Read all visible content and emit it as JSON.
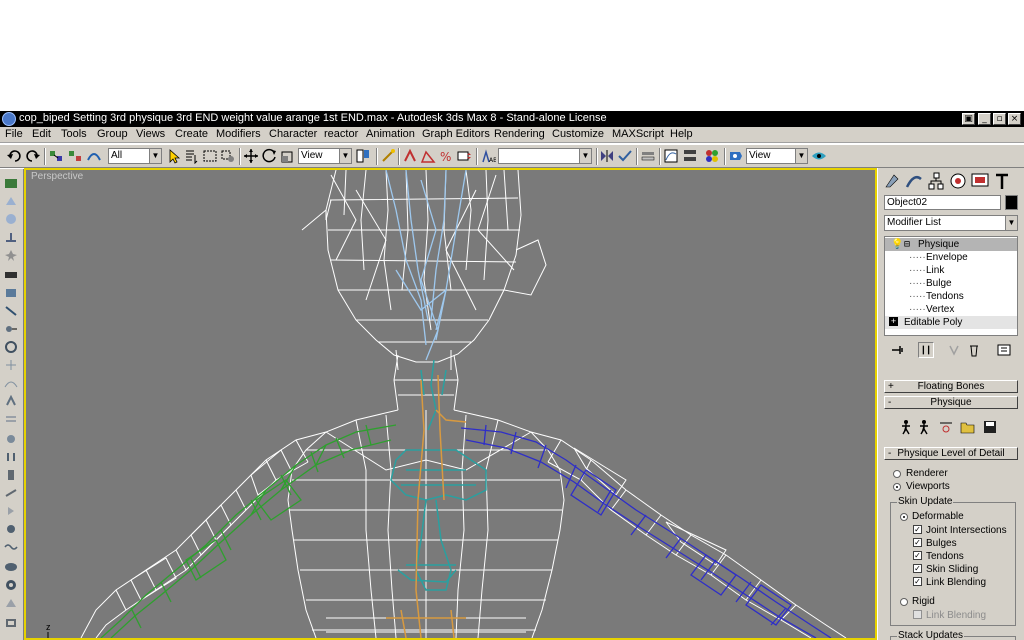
{
  "window": {
    "title": "cop_biped Setting 3rd physique 3rd END weight value arange 1st END.max - Autodesk 3ds Max 8  - Stand-alone License",
    "controls": [
      "▣",
      "_",
      "▫",
      "×"
    ]
  },
  "menu": [
    "File",
    "Edit",
    "Tools",
    "Group",
    "Views",
    "Create",
    "Modifiers",
    "Character",
    "reactor",
    "Animation",
    "Graph Editors",
    "Rendering",
    "Customize",
    "MAXScript",
    "Help"
  ],
  "toolbar": {
    "selection_filter": "All",
    "ref_coord": "View",
    "named_selection": "",
    "render_view": "View"
  },
  "viewport": {
    "label": "Perspective",
    "axis_label": "z",
    "border_color": "#e6d200",
    "background": "#7a7a7a"
  },
  "command_panel": {
    "object_name": "Object02",
    "modifier_list": "Modifier List",
    "stack": {
      "physique": "Physique",
      "sub_items": [
        "Envelope",
        "Link",
        "Bulge",
        "Tendons",
        "Vertex"
      ],
      "editable_poly": "Editable Poly"
    },
    "rollouts": {
      "floating_bones": "Floating Bones",
      "physique": "Physique",
      "level_of_detail": "Physique Level of Detail",
      "stack_updates": "Stack Updates"
    },
    "lod": {
      "renderer": "Renderer",
      "viewports": "Viewports",
      "skin_update": "Skin Update",
      "deformable": "Deformable",
      "checks": [
        {
          "label": "Joint Intersections",
          "checked": true
        },
        {
          "label": "Bulges",
          "checked": true
        },
        {
          "label": "Tendons",
          "checked": true
        },
        {
          "label": "Skin Sliding",
          "checked": true
        },
        {
          "label": "Link Blending",
          "checked": true
        }
      ],
      "rigid": "Rigid",
      "rigid_link_blending": "Link Blending"
    }
  },
  "colors": {
    "wire": "#ffffff",
    "left_arm_bones": "#2ea02e",
    "right_arm_bones": "#2e2ec8",
    "spine_bones": "#2aa0a0",
    "biped_orange": "#d89a40",
    "head_bones": "#9ec8ee"
  }
}
